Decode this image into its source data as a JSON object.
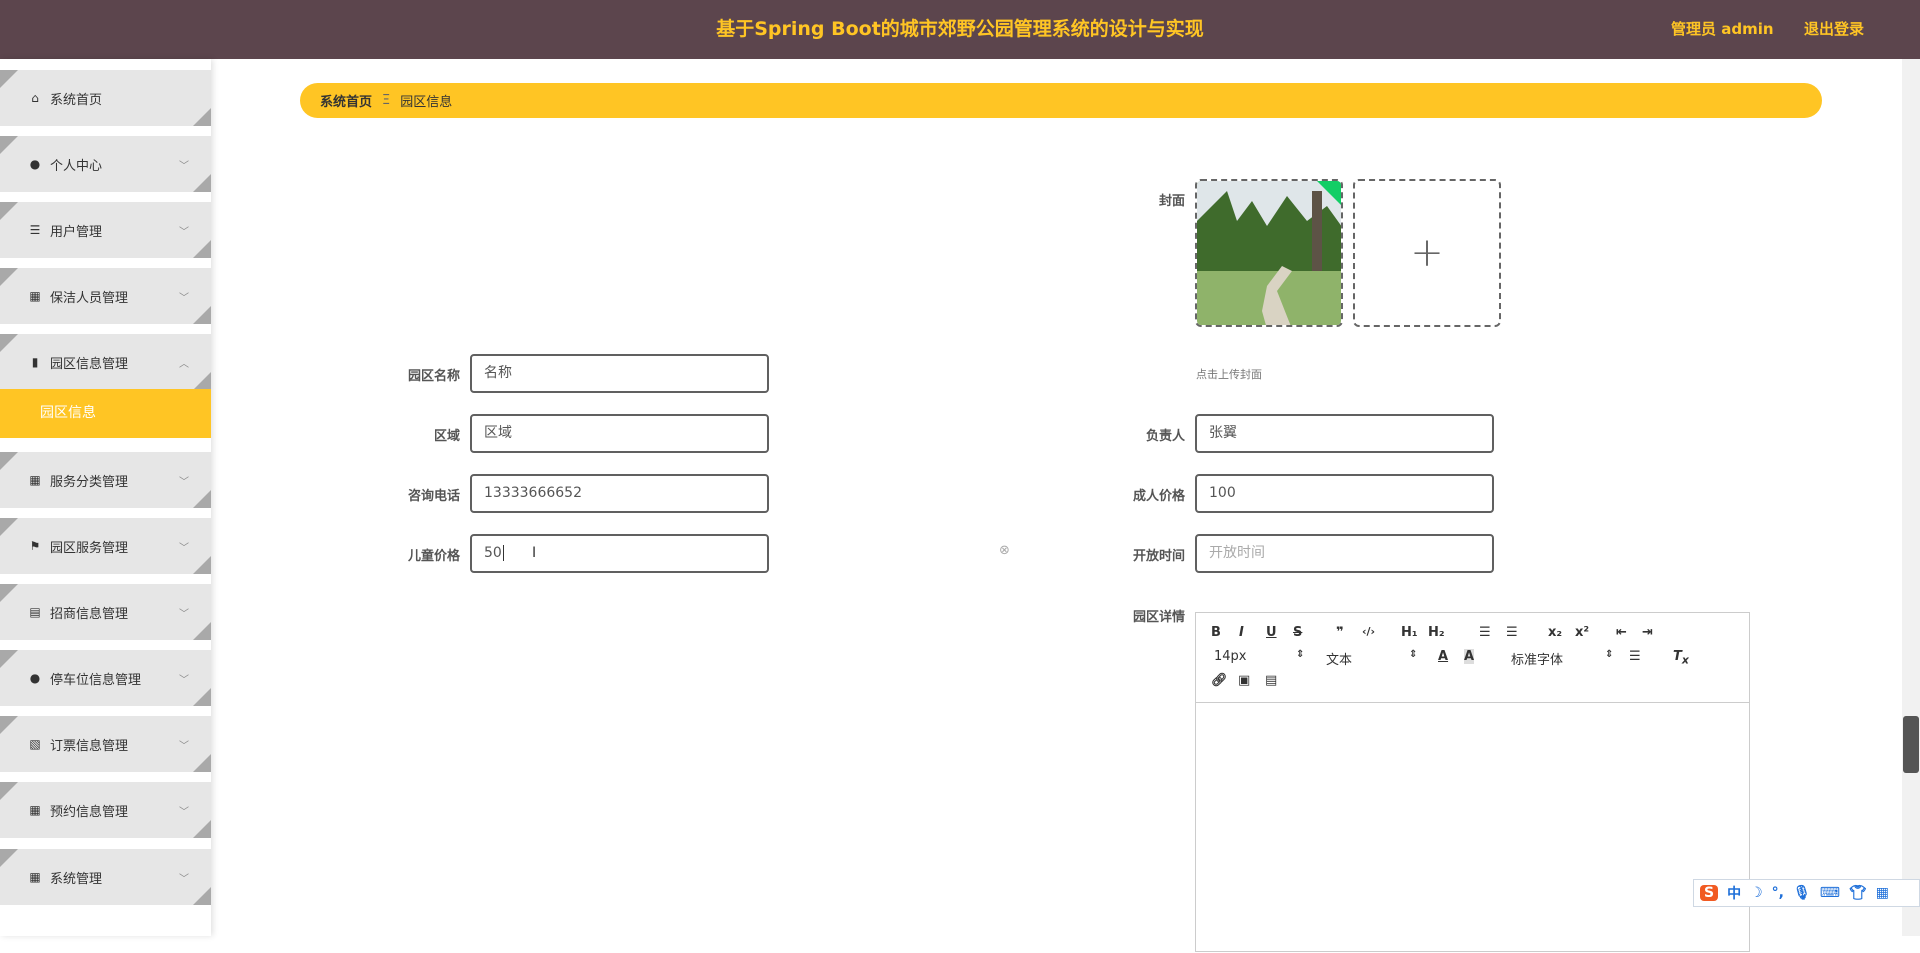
{
  "header": {
    "title": "基于Spring Boot的城市郊野公园管理系统的设计与实现",
    "user": "管理员 admin",
    "logout": "退出登录"
  },
  "sidebar": {
    "items": [
      {
        "label": "系统首页",
        "icon": "home-icon"
      },
      {
        "label": "个人中心",
        "icon": "user-icon"
      },
      {
        "label": "用户管理",
        "icon": "list-icon"
      },
      {
        "label": "保洁人员管理",
        "icon": "grid-icon"
      },
      {
        "label": "园区信息管理",
        "icon": "bar-chart-icon"
      },
      {
        "label": "服务分类管理",
        "icon": "grid-icon"
      },
      {
        "label": "园区服务管理",
        "icon": "flag-icon"
      },
      {
        "label": "招商信息管理",
        "icon": "clipboard-icon"
      },
      {
        "label": "停车位信息管理",
        "icon": "user-icon"
      },
      {
        "label": "订票信息管理",
        "icon": "clipboard-x-icon"
      },
      {
        "label": "预约信息管理",
        "icon": "grid-icon"
      },
      {
        "label": "系统管理",
        "icon": "grid-icon"
      }
    ],
    "active_sub": "园区信息"
  },
  "breadcrumb": {
    "home": "系统首页",
    "sep": "Ξ",
    "current": "园区信息"
  },
  "form": {
    "cover_label": "封面",
    "cover_hint": "点击上传封面",
    "name_label": "园区名称",
    "name_value": "名称",
    "region_label": "区域",
    "region_value": "区域",
    "manager_label": "负责人",
    "manager_value": "张翼",
    "phone_label": "咨询电话",
    "phone_value": "13333666652",
    "adult_label": "成人价格",
    "adult_value": "100",
    "child_label": "儿童价格",
    "child_value": "50",
    "open_label": "开放时间",
    "open_placeholder": "开放时间",
    "detail_label": "园区详情"
  },
  "editor": {
    "size": "14px",
    "format": "文本",
    "font": "标准字体"
  },
  "ime": {
    "lang": "中"
  }
}
